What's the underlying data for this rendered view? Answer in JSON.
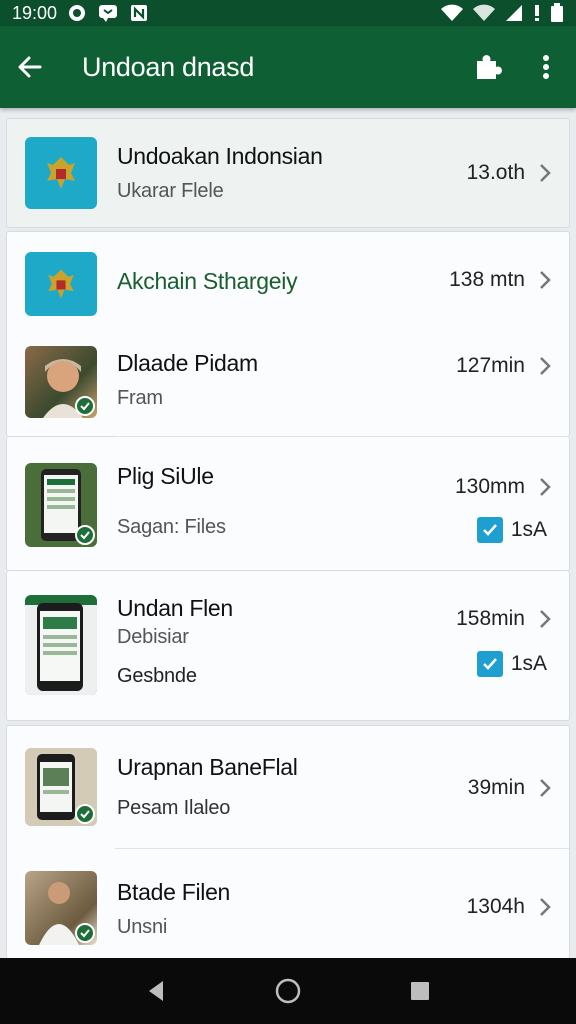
{
  "status_bar": {
    "time": "19:00"
  },
  "app_bar": {
    "title": "Undoan dnasd"
  },
  "items": [
    {
      "title": "Undoakan Indonsian",
      "subtitle": "Ukarar Flele",
      "meta": "13.oth",
      "icon": "indonesia-emblem-icon"
    },
    {
      "title": "Akchain Sthargeiy",
      "meta": "138 mtn",
      "icon": "indonesia-emblem-icon"
    },
    {
      "title": "Dlaade Pidam",
      "subtitle": "Fram",
      "meta": "127min",
      "icon": "person-photo"
    },
    {
      "title": "Plig SiUle",
      "subtitle": "Sagan: Files",
      "meta": "130mm",
      "checkbox_label": "1sA",
      "icon": "phone-screenshot"
    },
    {
      "title": "Undan Flen",
      "subtitle": "Debisiar",
      "subtitle2": "Gesbnde",
      "meta": "158min",
      "checkbox_label": "1sA",
      "icon": "phone-screenshot"
    },
    {
      "title": "Urapnan BaneFlal",
      "subtitle": "Pesam Ilaleo",
      "meta": "39min",
      "icon": "phone-screenshot"
    },
    {
      "title": "Btade Filen",
      "subtitle": "Unsni",
      "meta": "1304h",
      "icon": "person-photo"
    }
  ],
  "colors": {
    "app_bar": "#0f5f35",
    "status_bar": "#0b4f2c",
    "accent_checkbox": "#1f9fd0",
    "green_title": "#1a5e2f"
  }
}
